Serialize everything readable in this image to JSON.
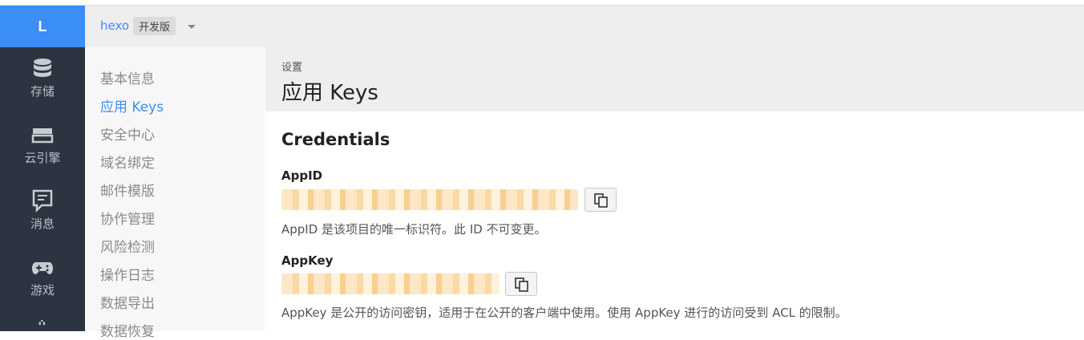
{
  "logo": "L",
  "rail": [
    {
      "label": "存储",
      "icon": "database-icon"
    },
    {
      "label": "云引擎",
      "icon": "server-icon"
    },
    {
      "label": "消息",
      "icon": "message-icon"
    },
    {
      "label": "游戏",
      "icon": "gamepad-icon"
    }
  ],
  "topbar": {
    "app_name": "hexo",
    "badge": "开发版"
  },
  "menu": {
    "items": [
      "基本信息",
      "应用 Keys",
      "安全中心",
      "域名绑定",
      "邮件模版",
      "协作管理",
      "风险检测",
      "操作日志",
      "数据导出",
      "数据恢复"
    ],
    "active": "应用 Keys"
  },
  "header": {
    "breadcrumb": "设置",
    "title": "应用 Keys"
  },
  "credentials": {
    "title": "Credentials",
    "appid": {
      "label": "AppID",
      "help": "AppID 是该项目的唯一标识符。此 ID 不可变更。"
    },
    "appkey": {
      "label": "AppKey",
      "help": "AppKey 是公开的访问密钥，适用于在公开的客户端中使用。使用 AppKey 进行的访问受到 ACL 的限制。"
    }
  },
  "colors": {
    "accent": "#3a8ef6",
    "rail_bg": "#2b3440"
  }
}
